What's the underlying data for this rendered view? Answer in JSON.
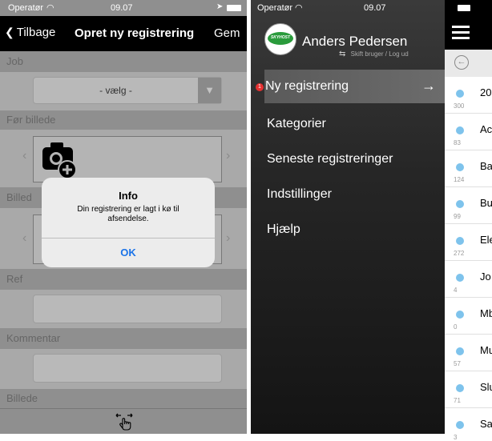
{
  "screen1": {
    "status": {
      "carrier": "Operatør",
      "time": "09.07"
    },
    "nav": {
      "back_label": "Tilbage",
      "title": "Opret ny registrering",
      "save_label": "Gem"
    },
    "sections": {
      "job": "Job",
      "before_photo": "Før billede",
      "photo_partial": "Billed",
      "ref": "Ref",
      "comment": "Kommentar",
      "photo": "Billede"
    },
    "job_select": {
      "value": "- vælg -"
    },
    "alert": {
      "title": "Info",
      "message": "Din registrering er lagt i kø til afsendelse.",
      "ok_label": "OK"
    }
  },
  "screen2": {
    "status": {
      "carrier": "Operatør",
      "time": "09.07"
    },
    "logo_text": "SKYHOST",
    "user": {
      "name": "Anders Pedersen",
      "switch_label": "Skift bruger / Log ud"
    },
    "menu": [
      {
        "label": "Ny registrering",
        "badge": "1"
      },
      {
        "label": "Kategorier"
      },
      {
        "label": "Seneste registreringer"
      },
      {
        "label": "Indstillinger"
      },
      {
        "label": "Hjælp"
      }
    ]
  },
  "screen3": {
    "rows": [
      {
        "label": "20",
        "count": "300"
      },
      {
        "label": "Ac",
        "count": "83"
      },
      {
        "label": "Ba",
        "count": "124"
      },
      {
        "label": "Bu",
        "count": "99"
      },
      {
        "label": "Ele",
        "count": "272"
      },
      {
        "label": "Jo",
        "count": "4"
      },
      {
        "label": "Mb",
        "count": "0"
      },
      {
        "label": "Mu",
        "count": "57"
      },
      {
        "label": "Slu",
        "count": "71"
      },
      {
        "label": "Sa",
        "count": "3"
      }
    ]
  }
}
